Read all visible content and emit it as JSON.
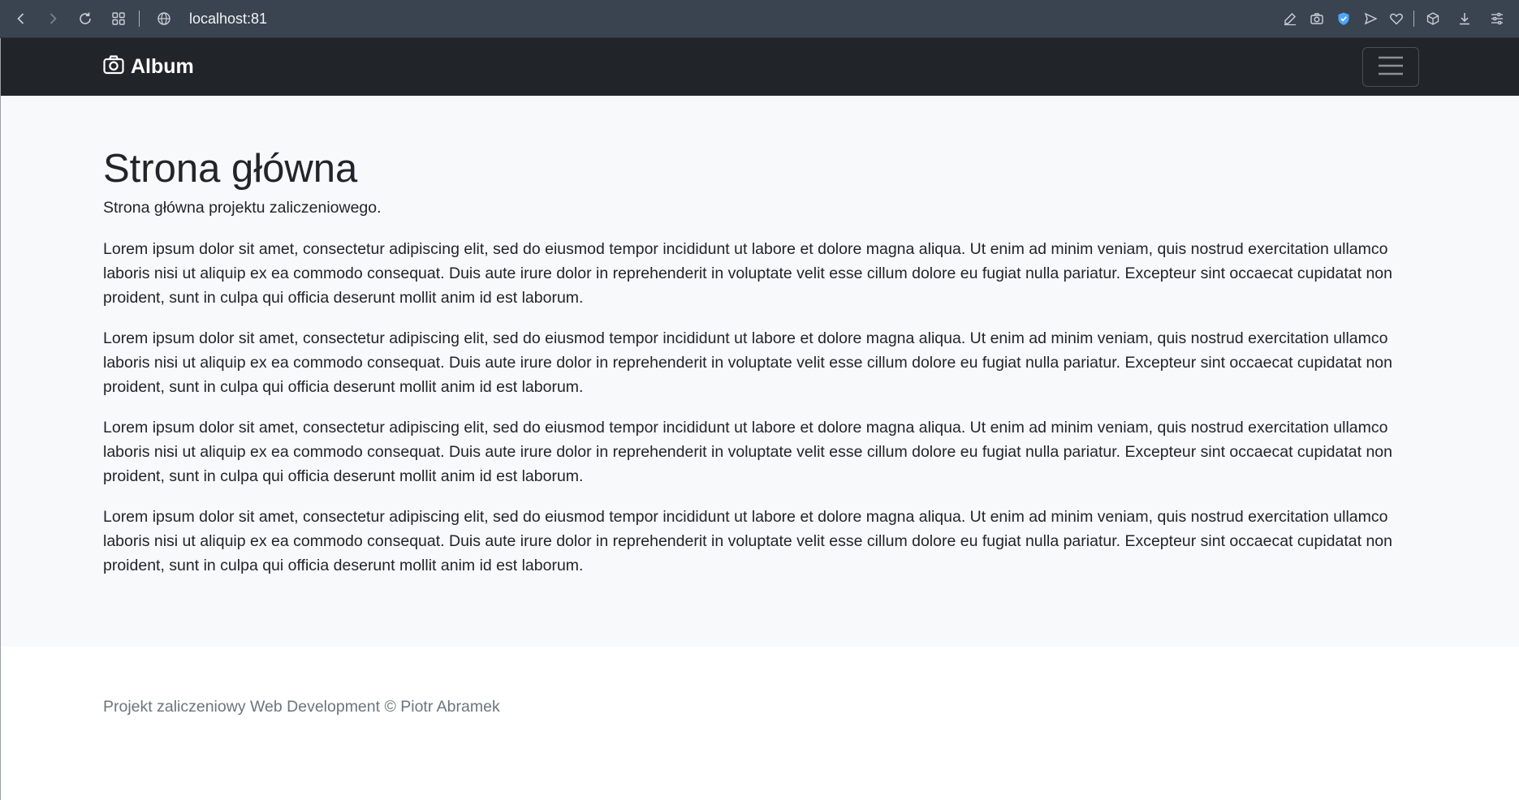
{
  "browser": {
    "url": "localhost:81",
    "icons": [
      "back-icon",
      "forward-icon",
      "reload-icon",
      "tabs-grid-icon",
      "globe-icon",
      "edit-icon",
      "camera-icon",
      "shield-icon",
      "send-icon",
      "heart-icon",
      "box-icon",
      "download-icon",
      "settings-sliders-icon"
    ]
  },
  "navbar": {
    "brand": "Album",
    "brand_icon": "camera-icon",
    "toggler_icon": "hamburger-icon",
    "background": "#212529"
  },
  "main": {
    "title": "Strona główna",
    "lead": "Strona główna projektu zaliczeniowego.",
    "paragraphs": [
      "Lorem ipsum dolor sit amet, consectetur adipiscing elit, sed do eiusmod tempor incididunt ut labore et dolore magna aliqua. Ut enim ad minim veniam, quis nostrud exercitation ullamco laboris nisi ut aliquip ex ea commodo consequat. Duis aute irure dolor in reprehenderit in voluptate velit esse cillum dolore eu fugiat nulla pariatur. Excepteur sint occaecat cupidatat non proident, sunt in culpa qui officia deserunt mollit anim id est laborum.",
      "Lorem ipsum dolor sit amet, consectetur adipiscing elit, sed do eiusmod tempor incididunt ut labore et dolore magna aliqua. Ut enim ad minim veniam, quis nostrud exercitation ullamco laboris nisi ut aliquip ex ea commodo consequat. Duis aute irure dolor in reprehenderit in voluptate velit esse cillum dolore eu fugiat nulla pariatur. Excepteur sint occaecat cupidatat non proident, sunt in culpa qui officia deserunt mollit anim id est laborum.",
      "Lorem ipsum dolor sit amet, consectetur adipiscing elit, sed do eiusmod tempor incididunt ut labore et dolore magna aliqua. Ut enim ad minim veniam, quis nostrud exercitation ullamco laboris nisi ut aliquip ex ea commodo consequat. Duis aute irure dolor in reprehenderit in voluptate velit esse cillum dolore eu fugiat nulla pariatur. Excepteur sint occaecat cupidatat non proident, sunt in culpa qui officia deserunt mollit anim id est laborum.",
      "Lorem ipsum dolor sit amet, consectetur adipiscing elit, sed do eiusmod tempor incididunt ut labore et dolore magna aliqua. Ut enim ad minim veniam, quis nostrud exercitation ullamco laboris nisi ut aliquip ex ea commodo consequat. Duis aute irure dolor in reprehenderit in voluptate velit esse cillum dolore eu fugiat nulla pariatur. Excepteur sint occaecat cupidatat non proident, sunt in culpa qui officia deserunt mollit anim id est laborum."
    ],
    "background": "#f8f9fa"
  },
  "footer": {
    "text": "Projekt zaliczeniowy Web Development © Piotr Abramek",
    "color": "#6c757d"
  }
}
